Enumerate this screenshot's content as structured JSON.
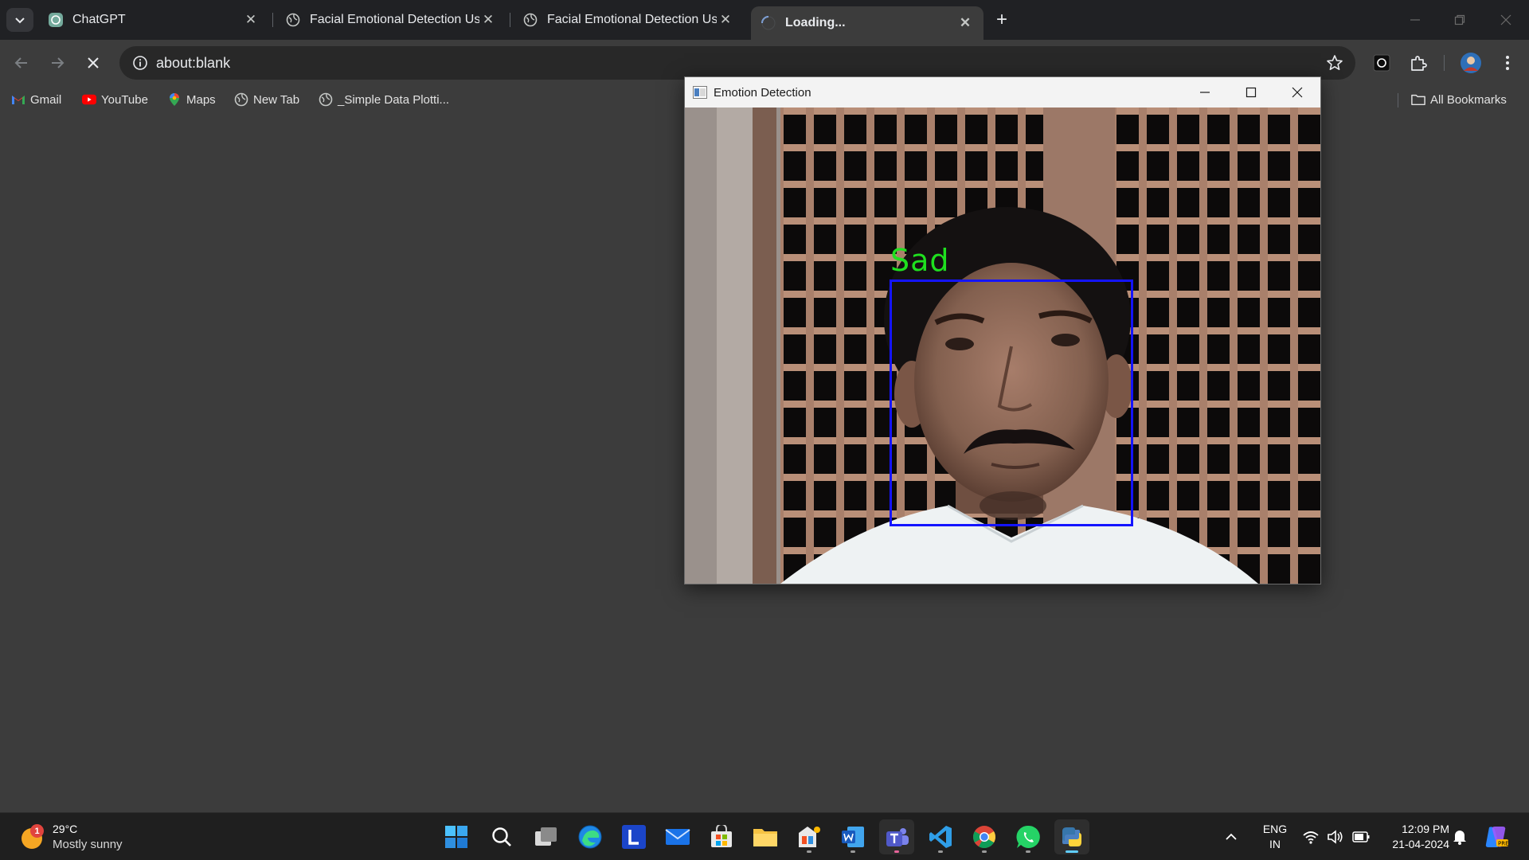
{
  "browser": {
    "tabs": [
      {
        "title": "ChatGPT",
        "favicon": "chatgpt-icon",
        "active": false
      },
      {
        "title": "Facial Emotional Detection Usi",
        "favicon": "globe-icon",
        "active": false
      },
      {
        "title": "Facial Emotional Detection Usi",
        "favicon": "globe-icon",
        "active": false
      },
      {
        "title": "Loading...",
        "favicon": "loading-spinner-icon",
        "active": true
      }
    ],
    "address_bar": {
      "url": "about:blank"
    },
    "bookmarks": [
      {
        "label": "Gmail",
        "icon": "gmail-icon"
      },
      {
        "label": "YouTube",
        "icon": "youtube-icon"
      },
      {
        "label": "Maps",
        "icon": "maps-icon"
      },
      {
        "label": "New Tab",
        "icon": "globe-icon"
      },
      {
        "label": "_Simple Data Plotti...",
        "icon": "globe-icon"
      }
    ],
    "all_bookmarks_label": "All Bookmarks"
  },
  "emotion_window": {
    "title": "Emotion Detection",
    "detected_emotion": "Sad",
    "label_color": "#1fe01f",
    "box_color": "#1414ff"
  },
  "taskbar": {
    "weather": {
      "badge": "1",
      "temperature": "29°C",
      "condition": "Mostly sunny"
    },
    "apps": [
      "start-icon",
      "search-icon",
      "task-view-icon",
      "edge-icon",
      "l-app-icon",
      "mail-icon",
      "store-icon",
      "file-explorer-icon",
      "paint-icon",
      "word-icon",
      "teams-icon",
      "vscode-icon",
      "chrome-icon",
      "whatsapp-icon",
      "python-icon"
    ],
    "language": {
      "line1": "ENG",
      "line2": "IN"
    },
    "clock": {
      "time": "12:09 PM",
      "date": "21-04-2024"
    }
  },
  "colors": {
    "tabstrip_bg": "#202124",
    "toolbar_bg": "#3c3c3c",
    "taskbar_bg": "#1f1f1f"
  }
}
